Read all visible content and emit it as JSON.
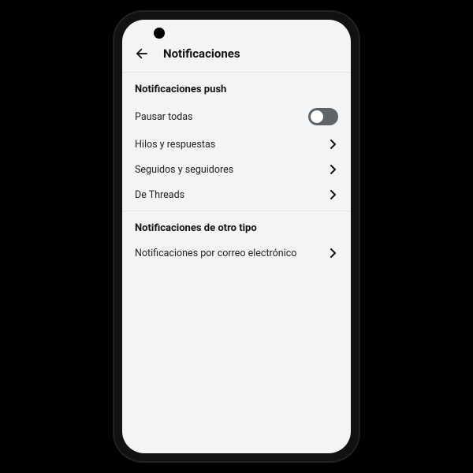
{
  "header": {
    "title": "Notificaciones"
  },
  "sections": [
    {
      "title": "Notificaciones push",
      "rows": [
        {
          "label": "Pausar todas",
          "type": "toggle",
          "on": false
        },
        {
          "label": "Hilos y respuestas",
          "type": "nav"
        },
        {
          "label": "Seguidos y seguidores",
          "type": "nav"
        },
        {
          "label": "De Threads",
          "type": "nav"
        }
      ]
    },
    {
      "title": "Notificaciones de otro tipo",
      "rows": [
        {
          "label": "Notificaciones por correo electrónico",
          "type": "nav"
        }
      ]
    }
  ]
}
